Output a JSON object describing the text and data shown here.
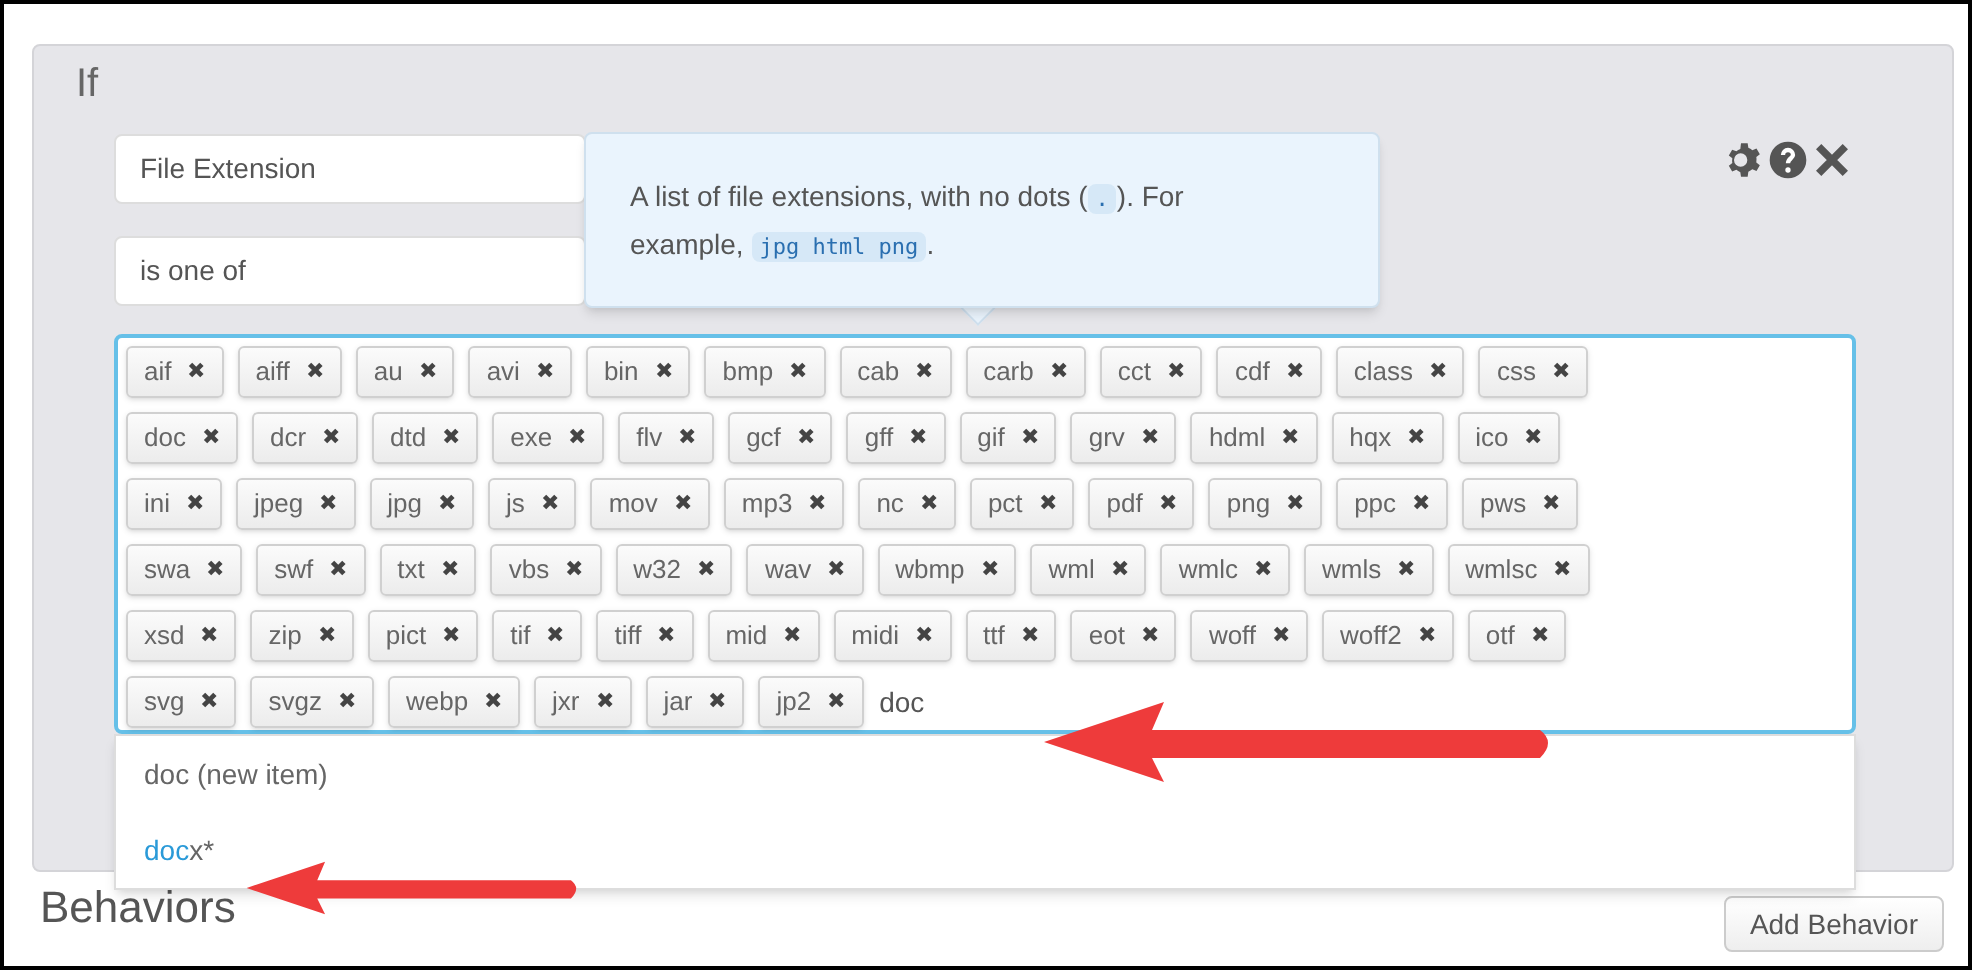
{
  "section_title": "If",
  "condition": {
    "field": "File Extension",
    "operator": "is one of"
  },
  "tooltip": {
    "parts": [
      {
        "kind": "text",
        "text": "A list of file extensions, with no dots ("
      },
      {
        "kind": "code",
        "text": "."
      },
      {
        "kind": "text",
        "text": "). For example, "
      },
      {
        "kind": "code",
        "text": "jpg html png"
      },
      {
        "kind": "text",
        "text": "."
      }
    ]
  },
  "tag_rows": [
    [
      "aif",
      "aiff",
      "au",
      "avi",
      "bin",
      "bmp",
      "cab",
      "carb",
      "cct",
      "cdf",
      "class",
      "css"
    ],
    [
      "doc",
      "dcr",
      "dtd",
      "exe",
      "flv",
      "gcf",
      "gff",
      "gif",
      "grv",
      "hdml",
      "hqx",
      "ico"
    ],
    [
      "ini",
      "jpeg",
      "jpg",
      "js",
      "mov",
      "mp3",
      "nc",
      "pct",
      "pdf",
      "png",
      "ppc",
      "pws"
    ],
    [
      "swa",
      "swf",
      "txt",
      "vbs",
      "w32",
      "wav",
      "wbmp",
      "wml",
      "wmlc",
      "wmls",
      "wmlsc"
    ],
    [
      "xsd",
      "zip",
      "pict",
      "tif",
      "tiff",
      "mid",
      "midi",
      "ttf",
      "eot",
      "woff",
      "woff2",
      "otf"
    ],
    [
      "svg",
      "svgz",
      "webp",
      "jxr",
      "jar",
      "jp2"
    ]
  ],
  "tag_remove_glyph": "✖",
  "typed_value": "doc",
  "suggestions": [
    {
      "text": "doc (new item)"
    },
    {
      "match": "doc",
      "text": "x*"
    }
  ],
  "behaviors_title": "Behaviors",
  "add_behavior_button": "Add Behavior"
}
